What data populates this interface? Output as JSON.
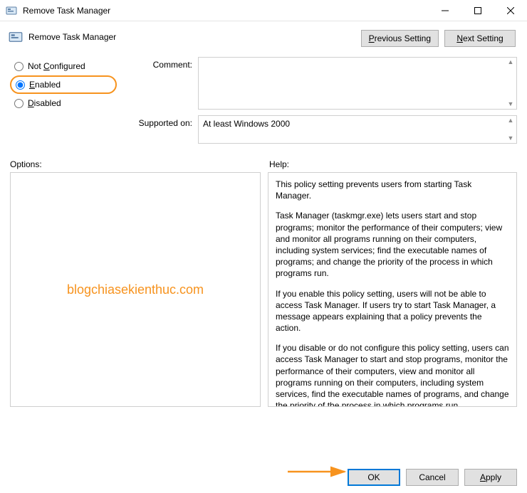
{
  "titlebar": {
    "title": "Remove Task Manager"
  },
  "header": {
    "title": "Remove Task Manager",
    "prev_label_a": "P",
    "prev_label_b": "revious Setting",
    "next_label_a": "N",
    "next_label_b": "ext Setting"
  },
  "state": {
    "not_configured": {
      "label_a": "Not ",
      "label_b": "C",
      "label_c": "onfigured"
    },
    "enabled": {
      "label_a": "E",
      "label_b": "nabled"
    },
    "disabled": {
      "label_a": "D",
      "label_b": "isabled"
    }
  },
  "mid": {
    "comment_label": "Comment:",
    "supported_label": "Supported on:",
    "supported_value": "At least Windows 2000"
  },
  "lower": {
    "options_label": "Options:",
    "help_label": "Help:",
    "watermark": "blogchiasekienthuc.com",
    "help_p1": "This policy setting prevents users from starting Task Manager.",
    "help_p2": "Task Manager (taskmgr.exe) lets users start and stop programs; monitor the performance of their computers; view and monitor all programs running on their computers, including system services; find the executable names of programs; and change the priority of the process in which programs run.",
    "help_p3": "If you enable this policy setting, users will not be able to access Task Manager. If users try to start Task Manager, a message appears explaining that a policy prevents the action.",
    "help_p4": "If you disable or do not configure this policy setting, users can access Task Manager to  start and stop programs, monitor the performance of their computers, view and monitor all programs running on their computers, including system services, find the executable names of programs, and change the priority of the process in which programs run."
  },
  "footer": {
    "ok": "OK",
    "cancel": "Cancel",
    "apply_a": "A",
    "apply_b": "pply"
  },
  "colors": {
    "accent_orange": "#f7931e",
    "accent_blue": "#0078d7"
  }
}
